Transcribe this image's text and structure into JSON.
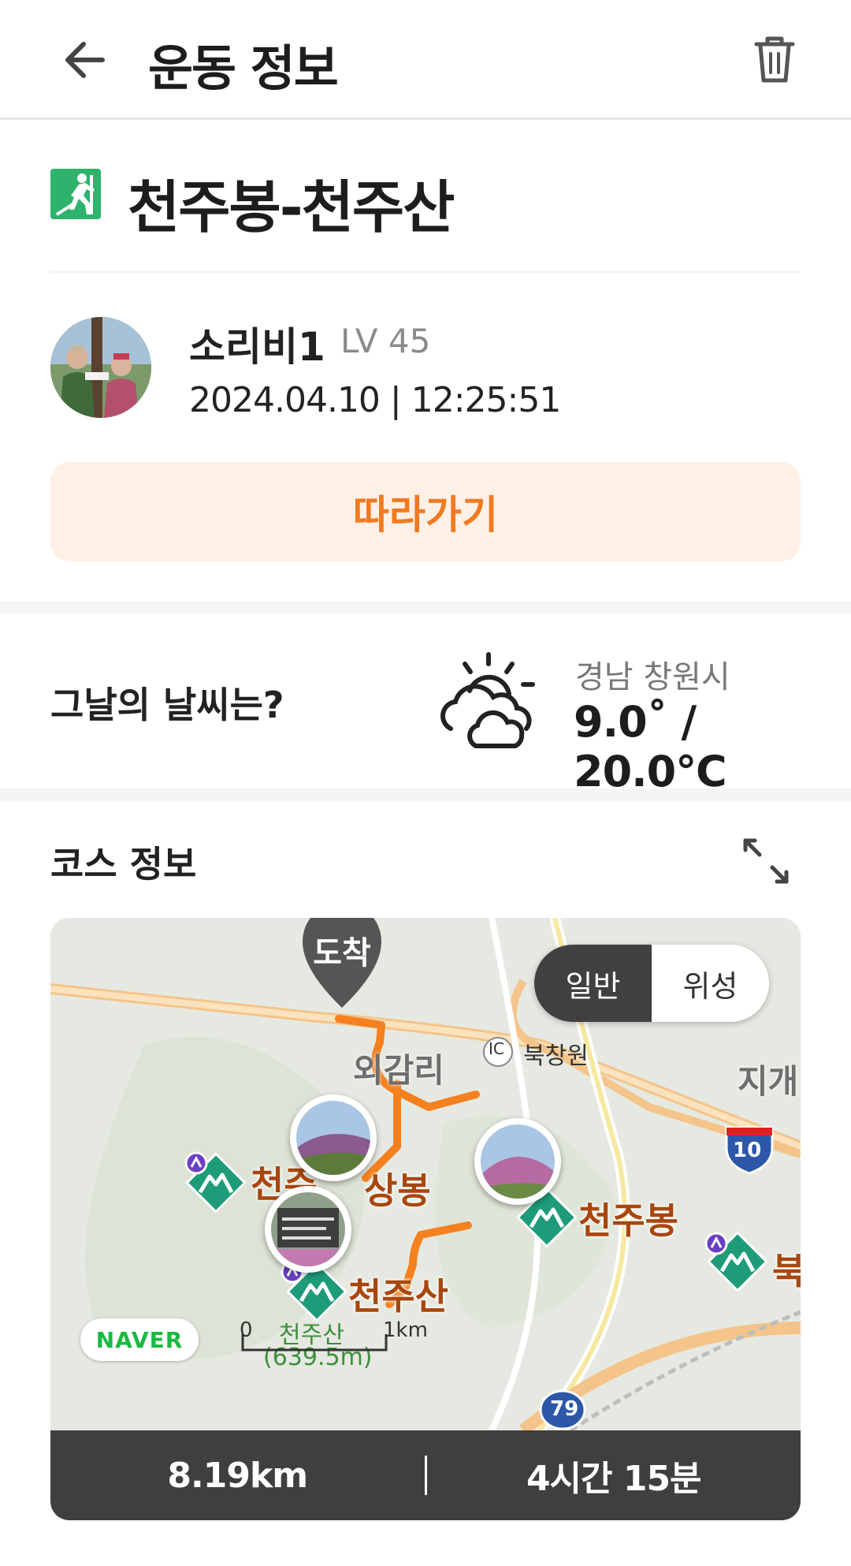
{
  "header": {
    "title": "운동 정보",
    "back_icon": "arrow-left-icon",
    "delete_icon": "trash-icon"
  },
  "course": {
    "name": "천주봉-천주산",
    "activity_icon": "hiking-icon",
    "accent_color": "#2db36b"
  },
  "user": {
    "name": "소리비1",
    "level": "LV 45",
    "datetime": "2024.04.10 | 12:25:51"
  },
  "follow_button": {
    "label": "따라가기",
    "text_color": "#f07a22",
    "bg_color": "#fff0e6"
  },
  "weather": {
    "question": "그날의 날씨는?",
    "icon": "partly-cloudy-icon",
    "location": "경남 창원시",
    "temperature": "9.0˚ / 20.0℃"
  },
  "course_info": {
    "title": "코스 정보",
    "expand_icon": "expand-icon"
  },
  "map": {
    "arrive_label": "도착",
    "toggle": {
      "normal": "일반",
      "satellite": "위성",
      "active": "일반"
    },
    "labels": {
      "village": "외감리",
      "ic": "IC",
      "ic_name": "북창원",
      "jigae": "지개",
      "peak_left": "천주",
      "peak_sangbong": "상봉",
      "peak_cheonjubong": "천주봉",
      "peak_cheonjusan": "천주산",
      "peak_right": "북",
      "sub_name": "천주산",
      "sub_height": "(639.5m)"
    },
    "route_shields": {
      "highway": "10",
      "road": "79"
    },
    "naver_logo": "NAVER",
    "scale": {
      "start": "0",
      "end": "1km"
    },
    "route_color": "#f5801f"
  },
  "stats": {
    "distance": "8.19km",
    "duration": "4시간 15분"
  }
}
